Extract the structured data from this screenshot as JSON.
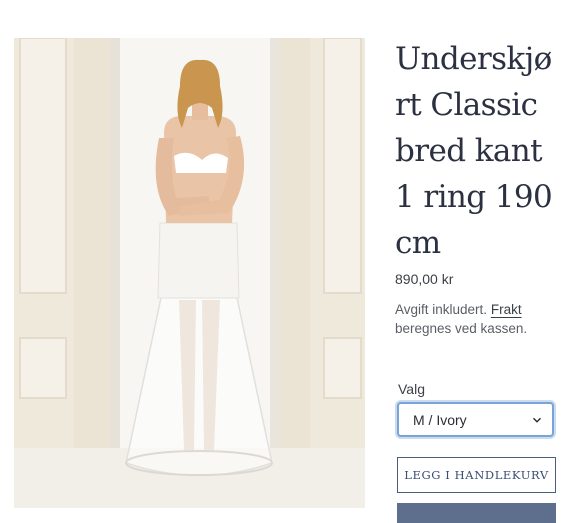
{
  "product": {
    "title": "Underskjørt Classic bred kant 1 ring 190cm",
    "price": "890,00 kr",
    "tax_note": "Avgift inkludert.",
    "shipping_link": "Frakt",
    "shipping_note": "beregnes ved kassen.",
    "image_alt": "Underskjørt Classic bred kant 1 ring 190cm"
  },
  "variant": {
    "label": "Valg",
    "selected": "M / Ivory"
  },
  "actions": {
    "add_to_cart": "LEGG I HANDLEKURV"
  },
  "icons": {
    "dropdown": "chevron-down-icon"
  },
  "colors": {
    "accent": "#3b4d73",
    "focus_ring": "#7aa3d6",
    "buy_button": "#5e6f8e"
  }
}
